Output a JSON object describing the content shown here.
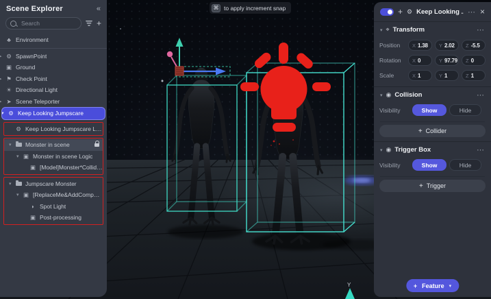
{
  "tooltip": {
    "key_glyph": "⌘",
    "text": "to apply increment snap"
  },
  "glyphs": {
    "plus": "+",
    "collapse": "«",
    "ellipsis": "⋯",
    "close": "×",
    "caret_down": "▾",
    "caret_right": "▸",
    "chevron_down": "▾",
    "gear": "⚙",
    "transform_icon": "⌖",
    "collision_icon": "◉",
    "trigger_icon": "◉"
  },
  "scene_explorer": {
    "title": "Scene Explorer",
    "search": {
      "placeholder": "Search"
    },
    "icon_glyphs": {
      "environment-icon": "♣",
      "gear-icon": "⚙",
      "cube-icon": "▣",
      "checkpoint-icon": "⚑",
      "light-icon": "☀",
      "teleporter-icon": "➤",
      "spotlight-icon": "◗"
    },
    "tree": [
      {
        "label": "Environment",
        "icon": "environment-icon",
        "indent": 0
      },
      {
        "divider": true
      },
      {
        "label": "SpawnPoint",
        "icon": "gear-icon",
        "indent": 0,
        "caret": "right"
      },
      {
        "label": "Ground",
        "icon": "cube-icon",
        "indent": 0
      },
      {
        "label": "Check Point",
        "icon": "checkpoint-icon",
        "indent": 0,
        "caret": "right"
      },
      {
        "label": "Directional Light",
        "icon": "light-icon",
        "indent": 0
      },
      {
        "label": "Scene Teleporter",
        "icon": "teleporter-icon",
        "indent": 0,
        "caret": "right"
      },
      {
        "label": "Keep Looking Jumpscare",
        "icon": "gear-icon",
        "indent": 0,
        "caret": "down",
        "selected": true
      },
      {
        "group": [
          {
            "label": "Keep Looking Jumpscare Logic",
            "icon": "gear-icon",
            "indent": 1
          }
        ]
      },
      {
        "group": [
          {
            "label": "Monster in scene",
            "icon": "folder-icon",
            "indent": 1,
            "caret": "down",
            "highlight": true,
            "lock": true
          },
          {
            "label": "Monster in scene Logic",
            "icon": "cube-icon",
            "indent": 2,
            "caret": "down"
          },
          {
            "label": "[Model]Monster*ColliderIsNec...",
            "icon": "cube-icon",
            "indent": 3
          }
        ]
      },
      {
        "group": [
          {
            "label": "Jumpscare Monster",
            "icon": "folder-icon",
            "indent": 1,
            "caret": "down"
          },
          {
            "label": "[ReplaceMe&AddComponent]J...",
            "icon": "cube-icon",
            "indent": 2,
            "caret": "down"
          },
          {
            "label": "Spot Light",
            "icon": "spotlight-icon",
            "indent": 3
          },
          {
            "label": "Post-processing",
            "icon": "cube-icon",
            "indent": 3
          }
        ]
      }
    ]
  },
  "inspector": {
    "title": "Keep Looking ...",
    "transform": {
      "title": "Transform",
      "axes": [
        "X",
        "Y",
        "Z"
      ],
      "rows": [
        {
          "label": "Position",
          "values": [
            "1.38",
            "2.02",
            "-5.5"
          ]
        },
        {
          "label": "Rotation",
          "values": [
            "0",
            "97.79",
            "0"
          ]
        },
        {
          "label": "Scale",
          "values": [
            "1",
            "1",
            "1"
          ]
        }
      ]
    },
    "collision": {
      "title": "Collision",
      "visibility_label": "Visibility",
      "show": "Show",
      "hide": "Hide",
      "add_label": "Collider"
    },
    "trigger_box": {
      "title": "Trigger Box",
      "visibility_label": "Visibility",
      "show": "Show",
      "hide": "Hide",
      "add_label": "Trigger"
    },
    "feature_label": "Feature"
  },
  "viewport": {
    "y_axis_label": "Y"
  },
  "colors": {
    "accent": "#5457dd",
    "selection": "#4a4ddb",
    "annotation_red": "#d32020",
    "wireframe_cyan": "#3fd9c4",
    "bulb_red": "#e8211a",
    "axis_blue": "#4a79f2",
    "axis_teal": "#3ecfae",
    "axis_pink": "#e0679f"
  }
}
